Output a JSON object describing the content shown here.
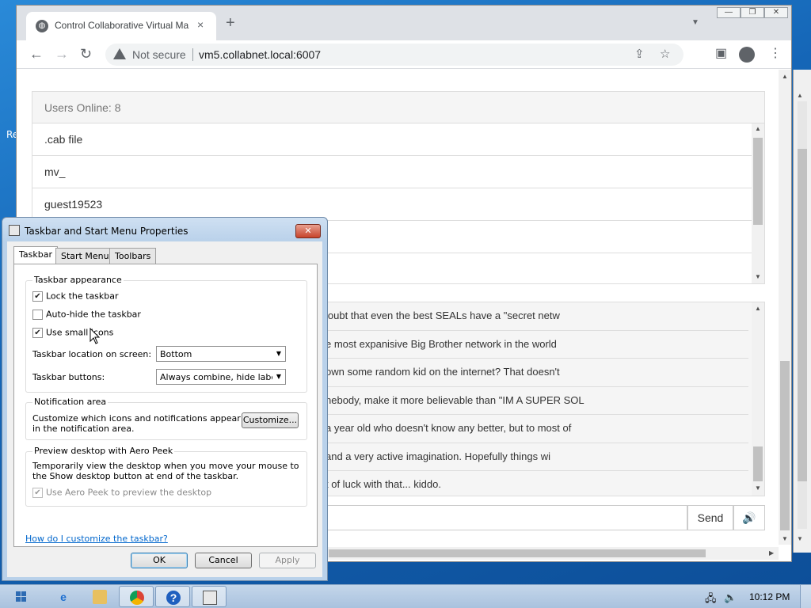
{
  "desktop": {
    "left_fragment_1": "Re",
    "left_fragment_2": "R"
  },
  "browser": {
    "tab": {
      "title": "Control Collaborative Virtual Ma",
      "favicon": "globe-icon",
      "close": "×"
    },
    "new_tab": "+",
    "tab_menu": "⌄",
    "window_controls": {
      "minimize": "—",
      "maximize": "❐",
      "close": "✕"
    },
    "nav": {
      "back": "←",
      "forward": "→",
      "reload": "↻"
    },
    "omnibox": {
      "security_label": "Not secure",
      "url": "vm5.collabnet.local:6007"
    }
  },
  "page": {
    "users_header": "Users Online: 8",
    "users": [
      ".cab file",
      "mv_",
      "guest19523",
      "",
      ""
    ],
    "messages": [
      "loubt that even the best SEALs have a \"secret netw",
      "e most expanisive Big Brother network in the world",
      "own some random kid on the internet? That doesn't",
      "nebody, make it more believable than \"IM A SUPER SOL",
      "a year old who doesn't know any better, but to most of",
      "and a very active imagination. Hopefully things wi",
      "t of luck with that... kiddo."
    ],
    "send_label": "Send",
    "speaker_glyph": "🔊"
  },
  "dialog": {
    "title": "Taskbar and Start Menu Properties",
    "close_glyph": "✕",
    "tabs": [
      "Taskbar",
      "Start Menu",
      "Toolbars"
    ],
    "appearance": {
      "title": "Taskbar appearance",
      "lock": {
        "label": "Lock the taskbar",
        "checked": true
      },
      "autohide": {
        "label": "Auto-hide the taskbar",
        "checked": false
      },
      "small_icons": {
        "label": "Use small icons",
        "checked": true
      },
      "location_label": "Taskbar location on screen:",
      "location_value": "Bottom",
      "buttons_label": "Taskbar buttons:",
      "buttons_value": "Always combine, hide labels"
    },
    "notification": {
      "title": "Notification area",
      "text_line1": "Customize which icons and notifications appear",
      "text_line2": "in the notification area.",
      "customize_label": "Customize..."
    },
    "aero_peek": {
      "title": "Preview desktop with Aero Peek",
      "text_line1": "Temporarily view the desktop when you move your mouse to",
      "text_line2": "the Show desktop button at end of the taskbar.",
      "checkbox_label": "Use Aero Peek to preview the desktop",
      "checked": true
    },
    "help_link": "How do I customize the taskbar?",
    "ok_label": "OK",
    "cancel_label": "Cancel",
    "apply_label": "Apply"
  },
  "taskbar": {
    "apps": [
      "ie-icon",
      "explorer-folder-icon",
      "chrome-icon",
      "help-icon",
      "taskbar-properties-icon"
    ],
    "clock": "10:12 PM"
  },
  "colors": {
    "link": "#0066cc",
    "close_button": "#c7432b",
    "taskbar": "#b8cde6"
  }
}
